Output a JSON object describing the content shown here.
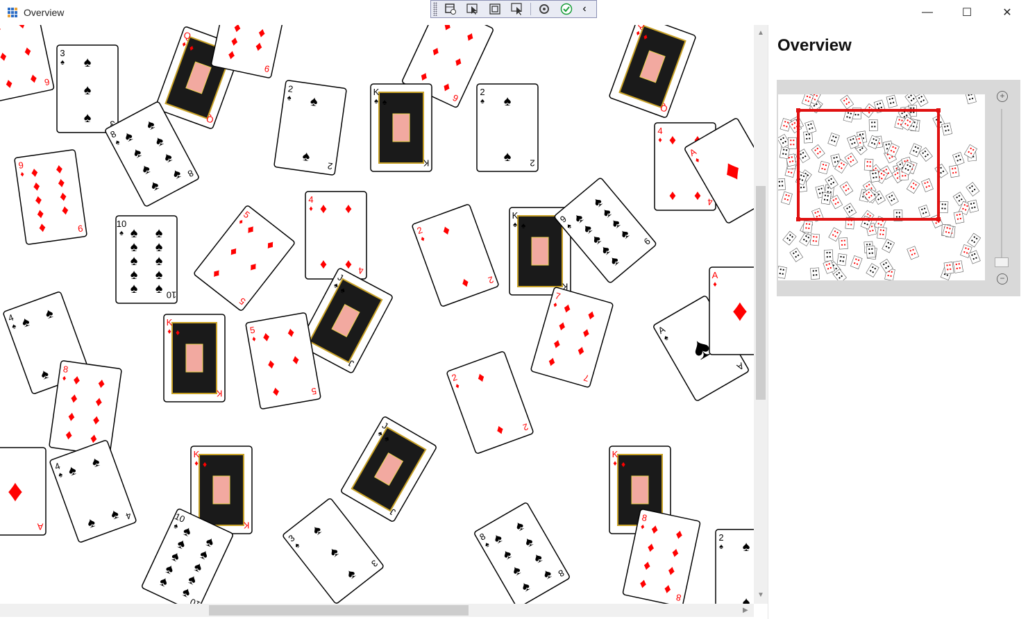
{
  "window": {
    "title": "Overview"
  },
  "title_buttons": {
    "minimize": "—",
    "maximize": "☐",
    "close": "✕"
  },
  "toolbar": {
    "collapse_glyph": "‹"
  },
  "panel": {
    "title": "Overview"
  },
  "zoom": {
    "in_glyph": "+",
    "out_glyph": "−"
  },
  "colors": {
    "red": "#ff0000",
    "black": "#000000",
    "accent": "#2b6cc4",
    "viewport": "#e01010"
  },
  "cards": [
    {
      "rank": "6",
      "suit": "♦"
    },
    {
      "rank": "3",
      "suit": "♠"
    },
    {
      "rank": "Q",
      "suit": "♦"
    },
    {
      "rank": "9",
      "suit": "♦"
    },
    {
      "rank": "6",
      "suit": "♦"
    },
    {
      "rank": "Q",
      "suit": "♦"
    },
    {
      "rank": "8",
      "suit": "♠"
    },
    {
      "rank": "2",
      "suit": "♠"
    },
    {
      "rank": "K",
      "suit": "♠"
    },
    {
      "rank": "2",
      "suit": "♠"
    },
    {
      "rank": "4",
      "suit": "♦"
    },
    {
      "rank": "A",
      "suit": "♦"
    },
    {
      "rank": "9",
      "suit": "♦"
    },
    {
      "rank": "10",
      "suit": "♠"
    },
    {
      "rank": "5",
      "suit": "♦"
    },
    {
      "rank": "4",
      "suit": "♦"
    },
    {
      "rank": "2",
      "suit": "♦"
    },
    {
      "rank": "K",
      "suit": "♠"
    },
    {
      "rank": "9",
      "suit": "♠"
    },
    {
      "rank": "J",
      "suit": "♠"
    },
    {
      "rank": "4",
      "suit": "♠"
    },
    {
      "rank": "K",
      "suit": "♦"
    },
    {
      "rank": "5",
      "suit": "♦"
    },
    {
      "rank": "7",
      "suit": "♦"
    },
    {
      "rank": "A",
      "suit": "♠"
    },
    {
      "rank": "A",
      "suit": "♦"
    },
    {
      "rank": "8",
      "suit": "♦"
    },
    {
      "rank": "2",
      "suit": "♦"
    },
    {
      "rank": "A",
      "suit": "♦"
    },
    {
      "rank": "4",
      "suit": "♠"
    },
    {
      "rank": "K",
      "suit": "♦"
    },
    {
      "rank": "J",
      "suit": "♠"
    },
    {
      "rank": "K",
      "suit": "♦"
    },
    {
      "rank": "10",
      "suit": "♠"
    },
    {
      "rank": "3",
      "suit": "♠"
    },
    {
      "rank": "8",
      "suit": "♠"
    },
    {
      "rank": "8",
      "suit": "♦"
    },
    {
      "rank": "2",
      "suit": "♠"
    }
  ]
}
